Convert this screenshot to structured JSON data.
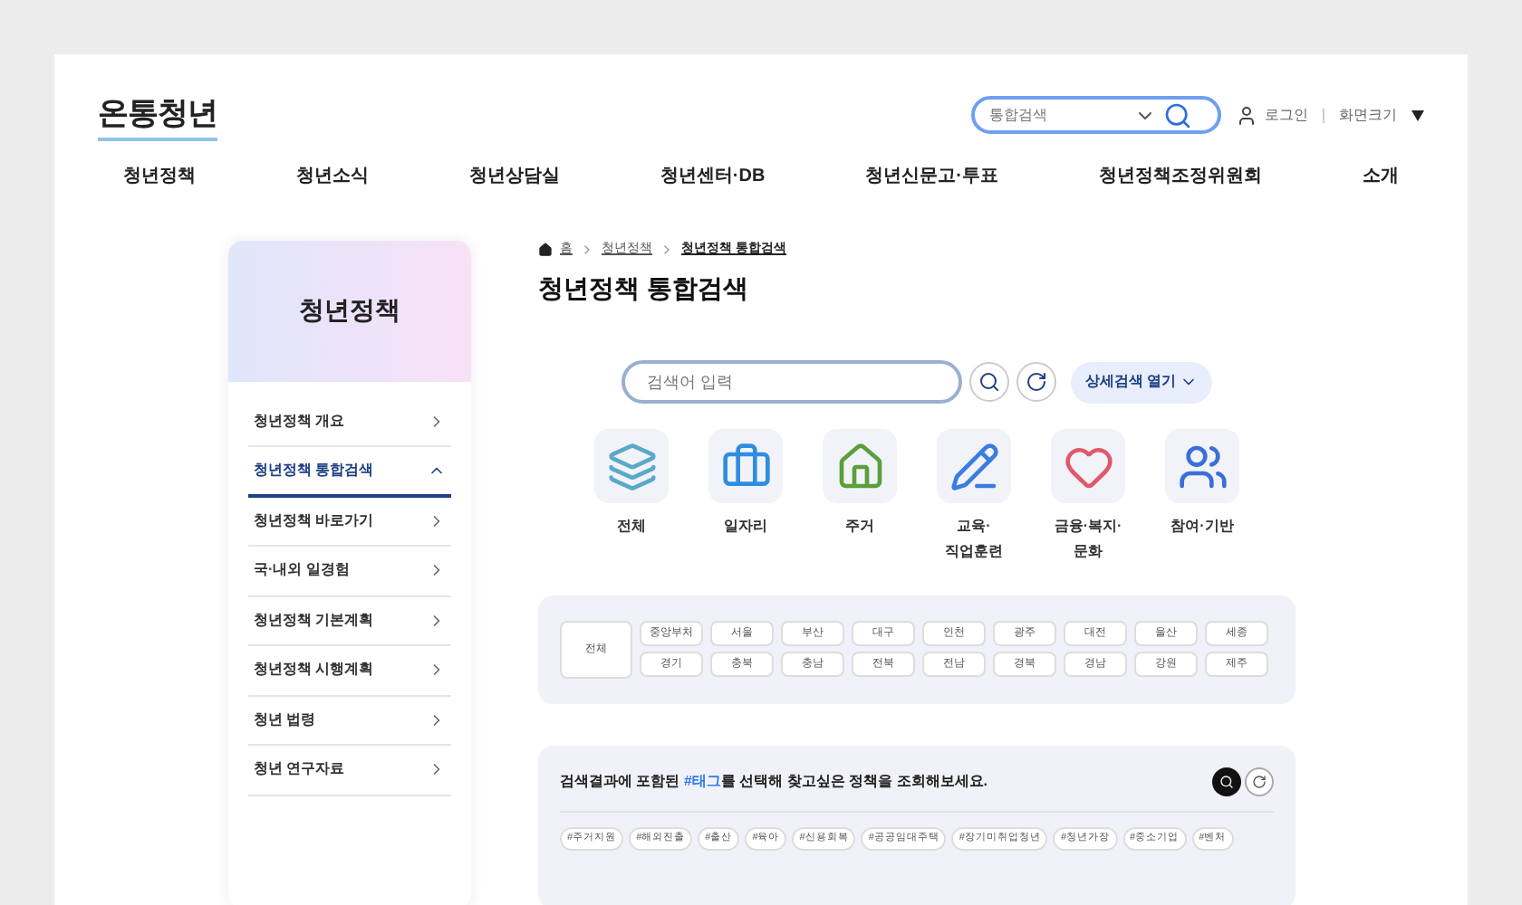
{
  "header": {
    "logo": "온통청년",
    "search": {
      "placeholder": "통합검색"
    },
    "login": "로그인",
    "screen_size": "화면크기"
  },
  "nav": [
    "청년정책",
    "청년소식",
    "청년상담실",
    "청년센터·DB",
    "청년신문고·투표",
    "청년정책조정위원회",
    "소개"
  ],
  "sidebar": {
    "title": "청년정책",
    "items": [
      {
        "label": "청년정책 개요",
        "selected": false
      },
      {
        "label": "청년정책 통합검색",
        "selected": true
      },
      {
        "label": "청년정책 바로가기",
        "selected": false
      },
      {
        "label": "국·내외 일경험",
        "selected": false
      },
      {
        "label": "청년정책 기본계획",
        "selected": false
      },
      {
        "label": "청년정책 시행계획",
        "selected": false
      },
      {
        "label": "청년 법령",
        "selected": false
      },
      {
        "label": "청년 연구자료",
        "selected": false
      }
    ]
  },
  "breadcrumb": [
    "홈",
    "청년정책",
    "청년정책 통합검색"
  ],
  "page_title": "청년정책 통합검색",
  "search": {
    "placeholder": "검색어 입력",
    "advanced": "상세검색 열기"
  },
  "categories": [
    {
      "kind": "layers",
      "label": "전체"
    },
    {
      "kind": "briefcase",
      "label": "일자리"
    },
    {
      "kind": "house",
      "label": "주거"
    },
    {
      "kind": "pencil",
      "label": "교육·\n직업훈련"
    },
    {
      "kind": "hearts",
      "label": "금융·복지·\n문화"
    },
    {
      "kind": "people",
      "label": "참여·기반"
    }
  ],
  "regions": {
    "all": "전체",
    "rows": [
      [
        "중앙부처",
        "서울",
        "부산",
        "대구",
        "인천",
        "광주",
        "대전",
        "울산",
        "세종"
      ],
      [
        "경기",
        "충북",
        "충남",
        "전북",
        "전남",
        "경북",
        "경남",
        "강원",
        "제주"
      ]
    ]
  },
  "tag_panel": {
    "message": "검색결과에 포함된 **#태그**를 선택해 찾고싶은 정책을 조회해보세요.",
    "tags": [
      "#주거지원",
      "#해외진출",
      "#출산",
      "#육아",
      "#신용회복",
      "#공공임대주택",
      "#장기미취업청년",
      "#청년가장",
      "#중소기업",
      "#벤처"
    ]
  }
}
